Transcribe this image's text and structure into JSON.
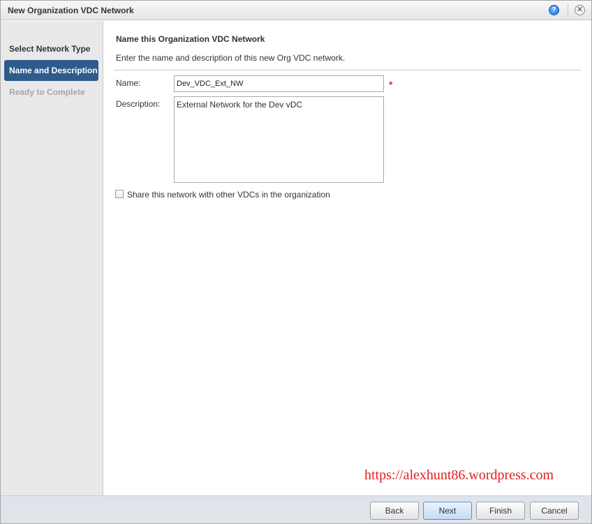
{
  "window": {
    "title": "New Organization VDC Network",
    "help_glyph": "?",
    "close_glyph": "✕"
  },
  "steps": [
    {
      "label": "Select Network Type",
      "state": "done"
    },
    {
      "label": "Name and Description",
      "state": "active"
    },
    {
      "label": "Ready to Complete",
      "state": "pending"
    }
  ],
  "form": {
    "section_title": "Name this Organization VDC Network",
    "section_description": "Enter the name and description of this new Org VDC network.",
    "name_label": "Name:",
    "name_value": "Dev_VDC_Ext_NW",
    "required_marker": "*",
    "description_label": "Description:",
    "description_value": "External Network for the Dev vDC",
    "share_label": "Share this network with other VDCs in the organization",
    "share_checked": false
  },
  "watermark": "https://alexhunt86.wordpress.com",
  "buttons": {
    "back": "Back",
    "next": "Next",
    "finish": "Finish",
    "cancel": "Cancel"
  },
  "colors": {
    "active_step_bg": "#2f5b8c",
    "required": "#d23a3a",
    "watermark": "#e02020"
  }
}
